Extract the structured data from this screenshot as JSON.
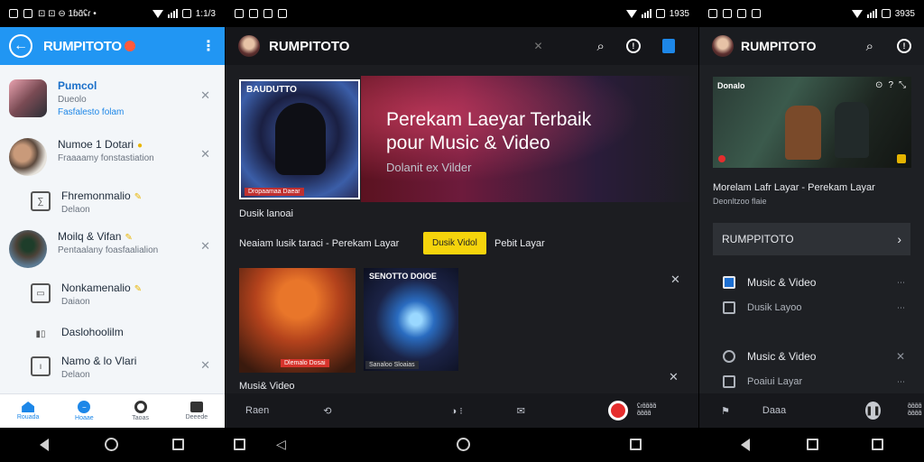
{
  "panel1": {
    "status": {
      "left": "⊡ ⊡ ⊖ 1ɓɑ̃ʢɾ •",
      "time": "1:1/3"
    },
    "title": "RUMPITOTO",
    "chats": [
      {
        "name": "Pumcol",
        "sub1": "Dueolo",
        "sub2": "Fasfalesto folam"
      },
      {
        "name": "Numoe 1 Dotari",
        "sub1": "Fraaaamy fonstastiation"
      },
      {
        "name": "Fhremonmalio",
        "sub1": "Delaon"
      },
      {
        "name": "Moilq & Vifan",
        "sub1": "Pentaalany foasfaalialion"
      },
      {
        "name": "Nonkamenalio",
        "sub1": "Daiaon"
      },
      {
        "name": "Daslohoolilm"
      },
      {
        "name": "Namo & lo Vlari",
        "sub1": "Delaon"
      }
    ],
    "nav": [
      "Rouada",
      "Hoaae",
      "Taoas",
      "Deeede"
    ]
  },
  "panel2": {
    "status": {
      "time": "1935"
    },
    "title": "RUMPITOTO",
    "hero": {
      "cover_title": "BAUDUTTO",
      "cover_tag": "Dropaamaa Daear",
      "title": "Perekam Laeyar Terbaik pour Music & Video",
      "subtitle": "Dolanit ex Vilder"
    },
    "cover_caption": "Dusik lanoai",
    "row_text": "Neaiam lusik taraci - Perekam Layar",
    "chip": "Dusik Vidol",
    "row_text2": "Pebit Layar",
    "tile1_tag": "Dlemalo Dosai",
    "tile2_title": "SENOTTO DOIOE",
    "tile2_tag": "Sanaloo Sloaias",
    "tile_caption": "Musi& Video",
    "bottom": {
      "left": "Raen",
      "stack": [
        "ʢɾɑ̃ɑ̃ɑ̃ɑ̃",
        "ɑ̃ɑ̃ɑ̃ɑ̃"
      ]
    }
  },
  "panel3": {
    "status": {
      "time": "3935"
    },
    "title": "RUMPITOTO",
    "video_title_overlay": "Donalo",
    "video_title": "Morelam Lafr Layar - Perekam Layar",
    "video_sub": "Deonltzoo flaie",
    "card": "RUMPPITOTO",
    "items": [
      {
        "label": "Music & Video",
        "sub": "Dusik Layoo"
      },
      {
        "label": "Music & Video",
        "sub": "Poaiui Layar"
      }
    ],
    "bottom": {
      "left": "Daaa",
      "stack": [
        "ɑ̃ɑ̃ɑ̃ɑ̃",
        "ɑ̃ɑ̃ɑ̃ɑ̃"
      ]
    }
  }
}
